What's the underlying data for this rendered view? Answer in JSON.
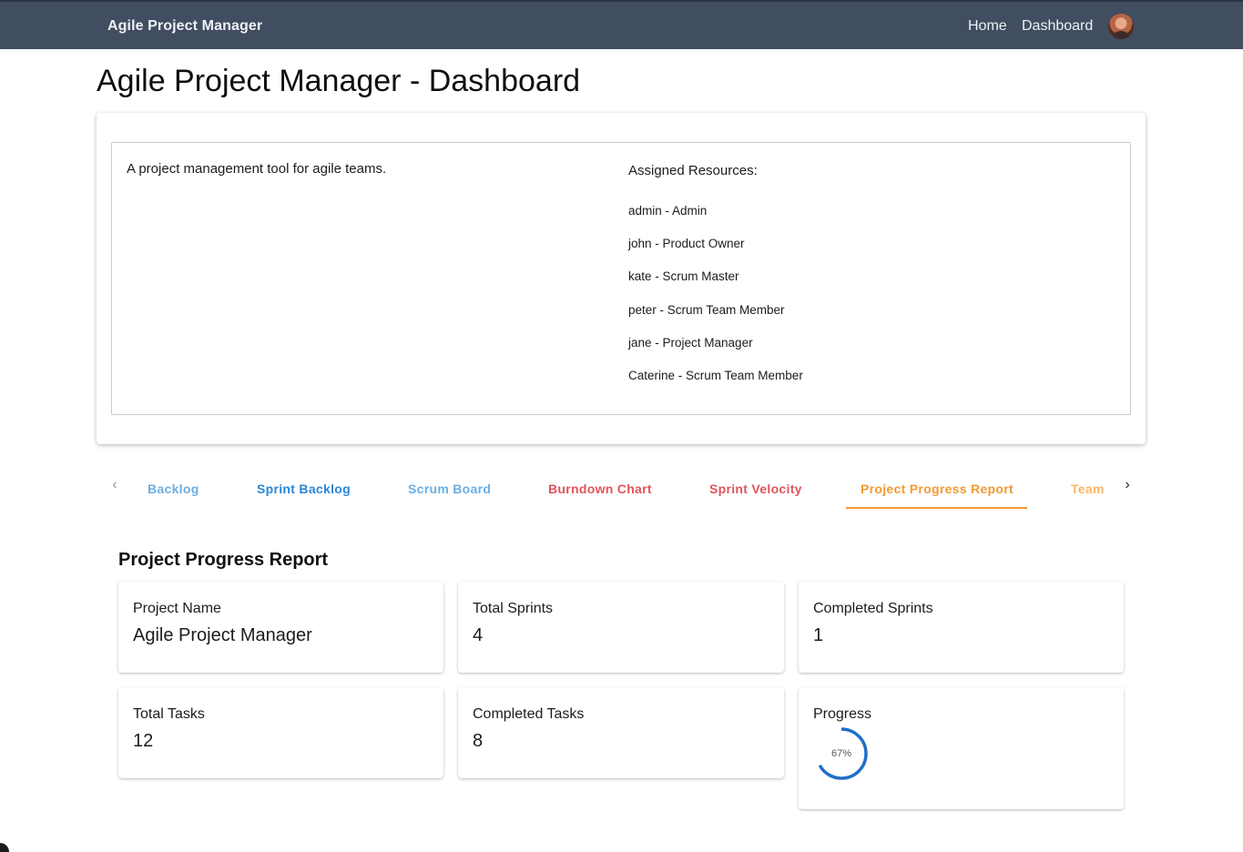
{
  "navbar": {
    "brand": "Agile Project Manager",
    "links": [
      "Home",
      "Dashboard"
    ],
    "background": "#414d60"
  },
  "page": {
    "title": "Agile Project Manager - Dashboard"
  },
  "project_info": {
    "description": "A project management tool for agile teams.",
    "resources_title": "Assigned Resources:",
    "resources": [
      "admin - Admin",
      "john - Product Owner",
      "kate - Scrum Master",
      "peter - Scrum Team Member",
      "jane - Project Manager",
      "Caterine - Scrum Team Member"
    ]
  },
  "tabs": {
    "items": [
      {
        "label": "Backlog",
        "color": "#6aaee2"
      },
      {
        "label": "Sprint Backlog",
        "color": "#2b86d6"
      },
      {
        "label": "Scrum Board",
        "color": "#6aaee2"
      },
      {
        "label": "Burndown Chart",
        "color": "#e0555a"
      },
      {
        "label": "Sprint Velocity",
        "color": "#e0555a"
      },
      {
        "label": "Project Progress Report",
        "color": "#f29a32"
      },
      {
        "label": "Team",
        "color": "#f6b768"
      }
    ],
    "active": "Project Progress Report"
  },
  "report": {
    "title": "Project Progress Report",
    "project_name_label": "Project Name",
    "project_name": "Agile Project Manager",
    "total_sprints_label": "Total Sprints",
    "total_sprints": "4",
    "completed_sprints_label": "Completed Sprints",
    "completed_sprints": "1",
    "total_tasks_label": "Total Tasks",
    "total_tasks": "12",
    "completed_tasks_label": "Completed Tasks",
    "completed_tasks": "8",
    "progress_label": "Progress",
    "progress_text": "67%",
    "progress_value": 0.67,
    "progress_color": "#1f6fc5"
  }
}
